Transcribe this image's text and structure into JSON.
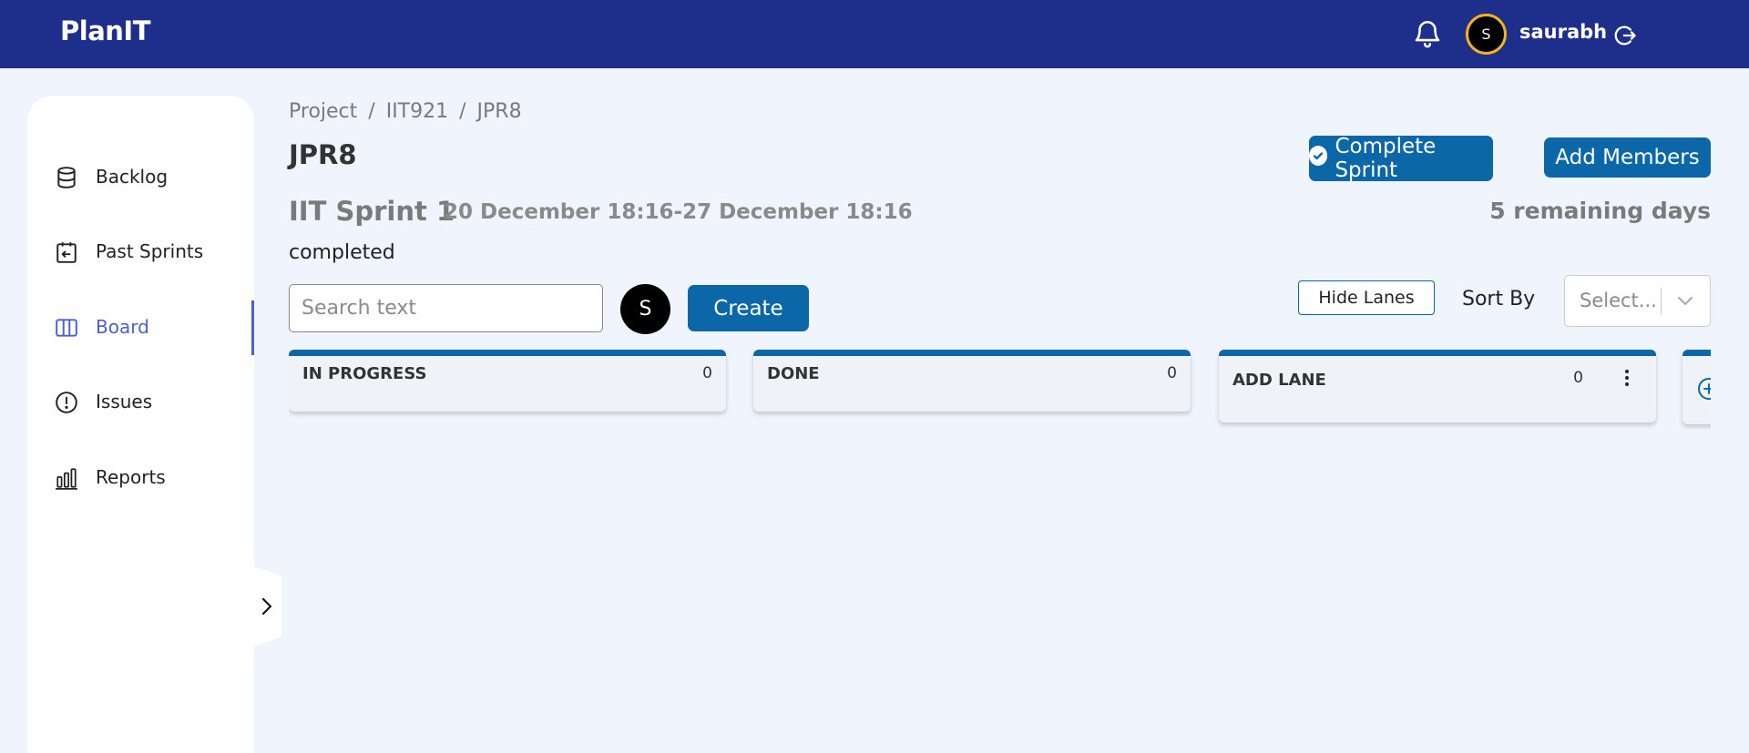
{
  "header": {
    "brand": "PlanIT",
    "user_initial": "S",
    "username": "saurabh"
  },
  "sidebar": {
    "items": [
      {
        "label": "Backlog",
        "icon": "database-icon"
      },
      {
        "label": "Past Sprints",
        "icon": "calendar-back-icon"
      },
      {
        "label": "Board",
        "icon": "board-columns-icon",
        "active": true
      },
      {
        "label": "Issues",
        "icon": "alert-circle-icon"
      },
      {
        "label": "Reports",
        "icon": "bar-chart-icon"
      }
    ]
  },
  "breadcrumb": [
    "Project",
    "IIT921",
    "JPR8"
  ],
  "page_title": "JPR8",
  "actions": {
    "complete_sprint": "Complete Sprint",
    "add_members": "Add Members"
  },
  "sprint": {
    "name": "IIT Sprint 1",
    "dates": "20 December 18:16-27 December 18:16",
    "remaining": "5 remaining days",
    "status": "completed"
  },
  "toolbar": {
    "search_placeholder": "Search text",
    "member_initial": "S",
    "create_label": "Create",
    "hide_lanes_label": "Hide Lanes",
    "sort_by_label": "Sort By",
    "sort_placeholder": "Select..."
  },
  "lanes": [
    {
      "name": "IN PROGRESS",
      "count": "0"
    },
    {
      "name": "DONE",
      "count": "0"
    },
    {
      "name": "ADD LANE",
      "count": "0"
    }
  ],
  "colors": {
    "header_bg": "#1e2e8b",
    "primary": "#0b67a8",
    "active_nav": "#4a61c9",
    "page_bg": "#eff4fd",
    "avatar_ring": "#f2b417"
  }
}
